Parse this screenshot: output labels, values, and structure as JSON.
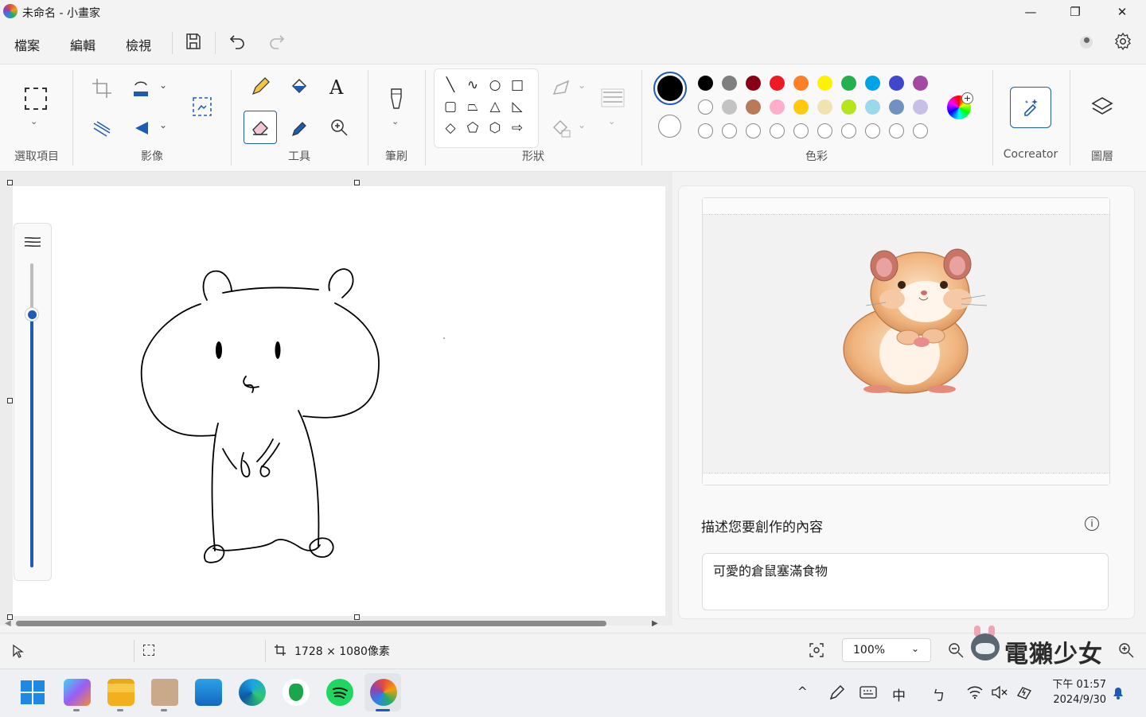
{
  "window": {
    "title": "未命名 - 小畫家",
    "minimize": "—",
    "restore": "❐",
    "close": "✕"
  },
  "menu": {
    "file": "檔案",
    "edit": "編輯",
    "view": "檢視"
  },
  "ribbon": {
    "groups": {
      "selection": "選取項目",
      "image": "影像",
      "tools": "工具",
      "brushes": "筆刷",
      "shapes": "形狀",
      "colors": "色彩",
      "cocreator": "Cocreator",
      "layers": "圖層"
    },
    "shape_glyphs": [
      "╲",
      "∿",
      "○",
      "□",
      "▢",
      "⏢",
      "△",
      "◺",
      "◇",
      "⬠",
      "⬡",
      "⇨"
    ],
    "colors": {
      "current_primary": "#000000",
      "current_secondary": "#ffffff",
      "row1": [
        "#000000",
        "#7f7f7f",
        "#880015",
        "#ed1c24",
        "#ff7f27",
        "#fff200",
        "#22b14c",
        "#00a2e8",
        "#3f48cc",
        "#a349a4"
      ],
      "row2": [
        "#ffffff",
        "#c3c3c3",
        "#b97a57",
        "#ffaec9",
        "#ffc90e",
        "#efe4b0",
        "#b5e61d",
        "#99d9ea",
        "#7092be",
        "#c8bfe7"
      ]
    }
  },
  "cocreator": {
    "prompt_label": "描述您要創作的內容",
    "prompt_value": "可愛的倉鼠塞滿食物"
  },
  "status": {
    "canvas_size": "1728 × 1080像素",
    "zoom": "100%"
  },
  "watermark": "電獺少女",
  "tray": {
    "ime": "中",
    "ime2": "ㄅ",
    "time": "下午 01:57",
    "date": "2024/9/30"
  }
}
